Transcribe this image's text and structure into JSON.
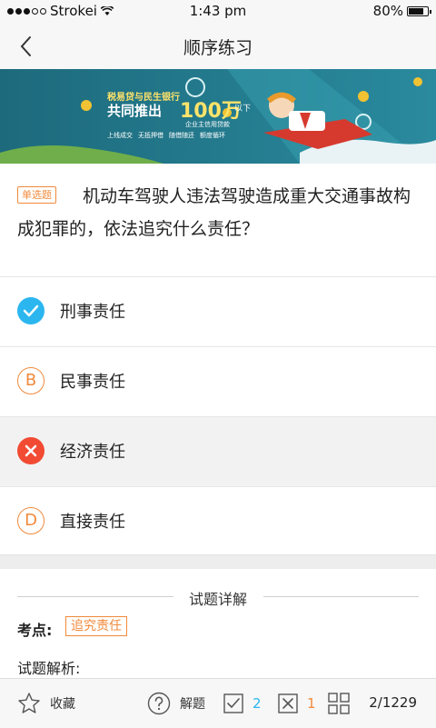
{
  "status_bar": {
    "carrier": "Strokei",
    "time": "1:43 pm",
    "battery": "80%",
    "battery_level": 0.8
  },
  "nav": {
    "title": "顺序练习",
    "back_icon": "chevron-left-icon"
  },
  "banner": {
    "line1": "税易贷与民生银行",
    "line2": "共同推出",
    "amount": "100万",
    "amount_suffix": "以下",
    "sub": "企业主信用贷款",
    "features": [
      "上线成交",
      "无抵押借",
      "随借随还",
      "额度循环"
    ]
  },
  "question": {
    "type_label": "单选题",
    "text": "机动车驾驶人违法驾驶造成重大交通事故构成犯罪的，依法追究什么责任？"
  },
  "options": [
    {
      "marker": "",
      "label": "刑事责任",
      "state": "correct"
    },
    {
      "marker": "B",
      "label": "民事责任",
      "state": "normal"
    },
    {
      "marker": "",
      "label": "经济责任",
      "state": "wrong"
    },
    {
      "marker": "D",
      "label": "直接责任",
      "state": "normal"
    }
  ],
  "detail": {
    "title": "试题详解",
    "point_label": "考点:",
    "point_value": "追究责任",
    "analysis_label": "试题解析:"
  },
  "bottom_bar": {
    "favorite_label": "收藏",
    "explain_label": "解题",
    "correct_count": "2",
    "wrong_count": "1",
    "progress": "2/1229"
  },
  "colors": {
    "accent_blue": "#2bb6ef",
    "wrong_red": "#f24b33",
    "tag_orange": "#f08a3c"
  }
}
